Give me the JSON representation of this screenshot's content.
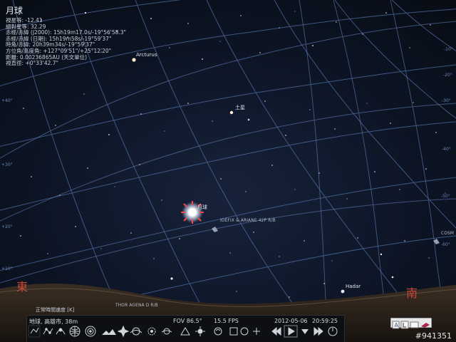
{
  "info": {
    "title": "月球",
    "lines": [
      "視星等: -12.41",
      "絕對星等: 32.29",
      "赤經/赤緯 (J2000): 15h19m17.0s/-19°56'58.3\"",
      "赤經/赤緯 (日期): 15h19m58s/-19°59'37\"",
      "時角/赤緯: 20h39m34s/-19°59'37\"",
      "方位角/高度角: +127°09'51\"/+25°12'20\"",
      "距離: 0.00236865AU (天文單位)",
      "視直徑: +0°33'42.7\""
    ]
  },
  "sky_labels": {
    "arcturus": "Arcturus",
    "saturn": "土星",
    "moon": "月球",
    "idefix": "IDEFIX & ARIANE 42P R/B",
    "hadar": "Hadar",
    "thor": "THOR AGENA D R/B",
    "cosmos": "COSM"
  },
  "cardinals": {
    "east": "東",
    "south": "南"
  },
  "grid_labels": [
    "-10°",
    "-20°",
    "-30°",
    "-40°",
    "-50°",
    "-60°",
    "+40°",
    "+30°",
    "+20°",
    "+10°"
  ],
  "statusbar": {
    "speed": "正常時間速度 [K]",
    "location": "地球, 高雄市, 38m",
    "fov": "FOV 86.5°",
    "fps": "15.5 FPS",
    "date": "2012-05-06",
    "time": "20:59:25"
  },
  "toolbar_icons": [
    "constellation-lines-icon",
    "constellation-labels-icon",
    "constellation-art-icon",
    "equatorial-grid-icon",
    "azimuthal-grid-icon",
    "ground-icon",
    "cardinal-points-icon",
    "atmosphere-icon",
    "nebula-icon",
    "planet-labels-icon",
    "mount-mode-icon",
    "center-object-icon",
    "night-mode-icon",
    "fullscreen-icon",
    "ocular-icon",
    "satellite-icon",
    "rewind-icon",
    "play-icon",
    "realtime-icon",
    "fast-forward-icon",
    "quit-icon"
  ],
  "build_id": "#941351"
}
